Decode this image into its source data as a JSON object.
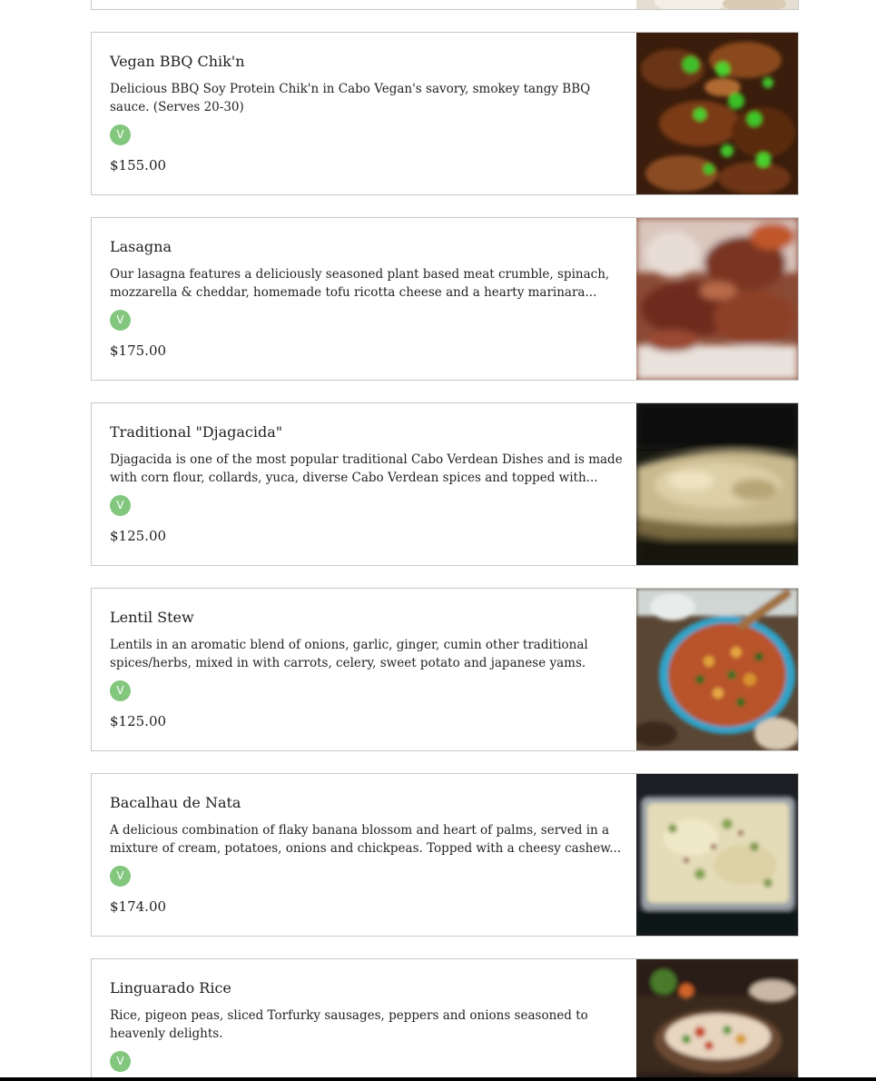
{
  "menu": {
    "items": [
      {
        "title": "Vegan BBQ Chik'n",
        "description": "Delicious BBQ Soy Protein Chik'n in Cabo Vegan's savory, smokey tangy BBQ sauce. (Serves 20-30)",
        "badge": "V",
        "price": "$155.00",
        "image_icon": "bbq-chikn-photo"
      },
      {
        "title": "Lasagna",
        "description": "Our lasagna features a deliciously seasoned plant based meat crumble, spinach, mozzarella & cheddar, homemade tofu ricotta cheese and a hearty marinara...",
        "badge": "V",
        "price": "$175.00",
        "image_icon": "lasagna-photo"
      },
      {
        "title": "Traditional \"Djagacida\"",
        "description": "Djagacida is one of the most popular traditional Cabo Verdean Dishes and is made with corn flour, collards, yuca, diverse Cabo Verdean spices and topped with...",
        "badge": "V",
        "price": "$125.00",
        "image_icon": "djagacida-photo"
      },
      {
        "title": "Lentil Stew",
        "description": "Lentils in an aromatic blend of onions, garlic, ginger, cumin other traditional spices/herbs, mixed in with carrots, celery, sweet potato and japanese yams.",
        "badge": "V",
        "price": "$125.00",
        "image_icon": "lentil-stew-photo"
      },
      {
        "title": "Bacalhau de Nata",
        "description": "A delicious combination of flaky banana blossom and heart of palms, served in a mixture of cream, potatoes, onions and chickpeas. Topped with a cheesy cashew...",
        "badge": "V",
        "price": "$174.00",
        "image_icon": "bacalhau-photo"
      },
      {
        "title": "Linguarado Rice",
        "description": "Rice, pigeon peas, sliced Torfurky sausages, peppers and onions seasoned to heavenly delights.",
        "badge": "V",
        "price": "",
        "image_icon": "linguarado-rice-photo"
      }
    ]
  },
  "colors": {
    "badge_green": "#83c77f",
    "card_border": "#c8c8c8",
    "text": "#222222"
  }
}
